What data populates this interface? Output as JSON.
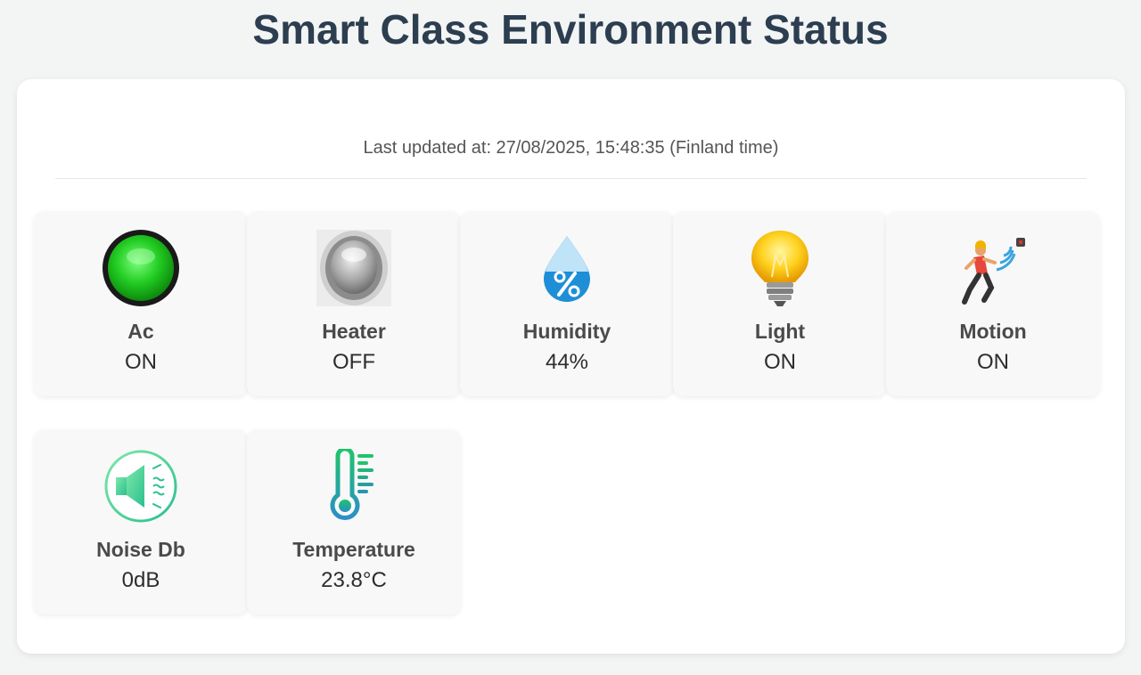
{
  "header": {
    "title": "Smart Class Environment Status"
  },
  "status": {
    "last_updated": "Last updated at: 27/08/2025, 15:48:35 (Finland time)"
  },
  "devices": [
    {
      "label": "Ac",
      "value": "ON",
      "icon": "green-led-icon"
    },
    {
      "label": "Heater",
      "value": "OFF",
      "icon": "grey-button-icon"
    },
    {
      "label": "Humidity",
      "value": "44%",
      "icon": "humidity-drop-icon"
    },
    {
      "label": "Light",
      "value": "ON",
      "icon": "light-bulb-icon"
    },
    {
      "label": "Motion",
      "value": "ON",
      "icon": "motion-sensor-icon"
    },
    {
      "label": "Noise Db",
      "value": "0dB",
      "icon": "speaker-icon"
    },
    {
      "label": "Temperature",
      "value": "23.8°C",
      "icon": "thermometer-icon"
    }
  ],
  "colors": {
    "title": "#2c3e50",
    "background": "#f3f4f4",
    "card": "#f8f8f8",
    "led_green": "#22cc22",
    "drop_blue": "#1e8fd6",
    "speaker_green": "#4cd39b",
    "thermo_teal": "#2aa7b8"
  }
}
